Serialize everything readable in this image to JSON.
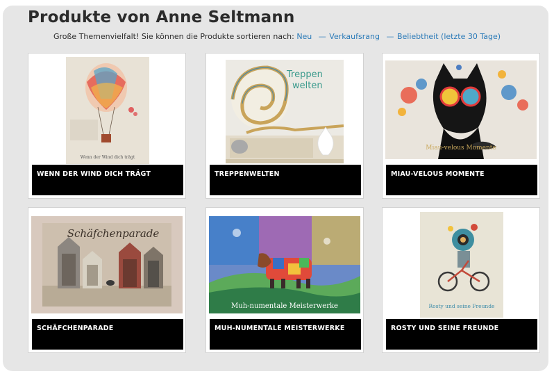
{
  "page": {
    "title": "Produkte von Anne Seltmann",
    "sort_intro": "Große Themenvielfalt! Sie können die Produkte sortieren nach:",
    "sort_options": [
      "Neu",
      "Verkaufsrang",
      "Beliebtheit (letzte 30 Tage)"
    ]
  },
  "products": [
    {
      "name": "WENN DER WIND DICH TRÄGT",
      "image_caption": "Wenn der Wind dich trägt",
      "image": "hot-air-balloon-calendar-cover"
    },
    {
      "name": "TREPPENWELTEN",
      "image_caption": "Treppen welten",
      "image": "spiral-staircase-calendar-cover"
    },
    {
      "name": "MIAU-VELOUS MOMENTE",
      "image_caption": "Miau-velous Momente",
      "image": "black-cat-sunglasses-calendar-cover"
    },
    {
      "name": "SCHÄFCHENPARADE",
      "image_caption": "Schäfchenparade",
      "image": "sheep-huts-calendar-cover"
    },
    {
      "name": "MUH-NUMENTALE MEISTERWERKE",
      "image_caption": "Muh-numentale Meisterwerke",
      "image": "patchwork-cow-calendar-cover"
    },
    {
      "name": "ROSTY UND SEINE FREUNDE",
      "image_caption": "Rosty und seine Freunde",
      "image": "robot-bicycle-calendar-cover"
    }
  ],
  "colors": {
    "panel": "#e6e6e6",
    "link": "#2a7ab8",
    "label_bg": "#000000",
    "title": "#2b2b2b"
  }
}
